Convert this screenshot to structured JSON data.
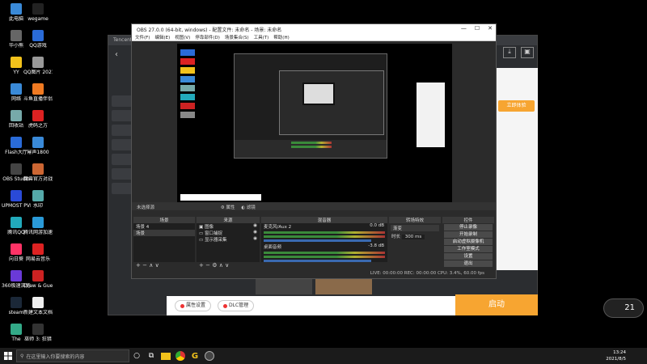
{
  "desktop_icons": [
    {
      "label": "此电脑",
      "color": "#3a8ad8"
    },
    {
      "label": "wegame",
      "color": "#222"
    },
    {
      "label": "华小熊",
      "color": "#666"
    },
    {
      "label": "QQ游戏",
      "color": "#2a6bd8"
    },
    {
      "label": "YY",
      "color": "#f2c21b"
    },
    {
      "label": "QQ图片\n20210724...",
      "color": "#999"
    },
    {
      "label": "网络",
      "color": "#3a8ad8"
    },
    {
      "label": "斗鱼直播伴侣",
      "color": "#f07a22"
    },
    {
      "label": "回收站",
      "color": "#7aa"
    },
    {
      "label": "虎码之方",
      "color": "#d22"
    },
    {
      "label": "Flash大厅",
      "color": "#2a6bd8"
    },
    {
      "label": "幂声1800",
      "color": "#3a8ad8"
    },
    {
      "label": "OBS Studio",
      "color": "#444"
    },
    {
      "label": "魔兽官方对战平台",
      "color": "#c63"
    },
    {
      "label": "UPMOST PVR",
      "color": "#2a4ad8"
    },
    {
      "label": "水印",
      "color": "#5aa"
    },
    {
      "label": "腾讯QQ",
      "color": "#2ab"
    },
    {
      "label": "腾讯网游加速器",
      "color": "#2a9ad8"
    },
    {
      "label": "向日葵",
      "color": "#f36"
    },
    {
      "label": "网易云音乐",
      "color": "#d22"
    },
    {
      "label": "360极速浏览器",
      "color": "#6a3ad8"
    },
    {
      "label": "Draw & Guess",
      "color": "#c22"
    },
    {
      "label": "steam",
      "color": "#1b2838"
    },
    {
      "label": "新建文本文档",
      "color": "#eee"
    },
    {
      "label": "The",
      "color": "#3a8"
    },
    {
      "label": "巫师 3: 狂猎",
      "color": "#333"
    }
  ],
  "background_app": {
    "title": "Tencent",
    "bottom_buttons": [
      "属性设置",
      "DLC管理"
    ],
    "start_label": "启动",
    "orange_chip": "立即体验"
  },
  "obs": {
    "title": "OBS 27.0.0 (64-bit, windows) - 配置文件: 未命名 - 场景: 未命名",
    "menu": [
      "文件(F)",
      "编辑(E)",
      "视图(V)",
      "停靠部件(D)",
      "场景集合(S)",
      "工具(T)",
      "帮助(H)"
    ],
    "no_source": "未选择源",
    "prop_label": "属性",
    "filter_label": "滤镜",
    "docks": {
      "scenes_title": "场景",
      "scenes": [
        "场景 4",
        "场景"
      ],
      "sources_title": "来源",
      "sources": [
        "图像",
        "窗口捕捉",
        "显示器采集"
      ],
      "mixer_title": "混音器",
      "mixer": [
        {
          "name": "麦克风/Aux 2",
          "db": "0.0 dB"
        },
        {
          "name": "桌面音频",
          "db": "-3.8 dB"
        }
      ],
      "transitions_title": "转场特效",
      "transition_value": "渐变",
      "duration_label": "时长",
      "duration_value": "300 ms",
      "controls_title": "控件",
      "controls": [
        "停止录像",
        "开始录制",
        "启动虚拟摄像机",
        "工作室模式",
        "设置",
        "退出"
      ]
    },
    "status": "LIVE: 00:00:00   REC: 00:00:00   CPU: 3.4%, 60.00 fps"
  },
  "widget_temp": "21",
  "taskbar": {
    "search_placeholder": "在这里输入你要搜索的内容",
    "time": "13:24",
    "date": "2021/8/5"
  }
}
